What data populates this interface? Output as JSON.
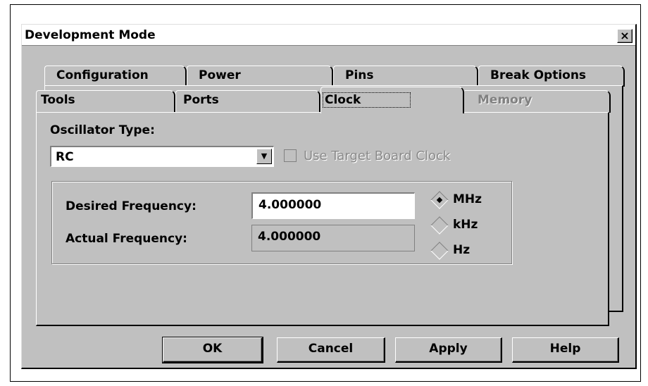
{
  "window": {
    "title": "Development Mode",
    "close_glyph": "×"
  },
  "tabs": {
    "back_row": [
      {
        "label": "Configuration"
      },
      {
        "label": "Power"
      },
      {
        "label": "Pins"
      },
      {
        "label": "Break Options"
      }
    ],
    "front_row": [
      {
        "label": "Tools"
      },
      {
        "label": "Ports"
      },
      {
        "label": "Clock",
        "selected": true
      },
      {
        "label": "Memory",
        "disabled": true
      }
    ]
  },
  "clock": {
    "oscillator_label": "Oscillator Type:",
    "oscillator_value": "RC",
    "use_target_board_clock": {
      "label": "Use Target Board Clock",
      "checked": false,
      "disabled": true
    },
    "desired_frequency": {
      "label": "Desired Frequency:",
      "value": "4.000000"
    },
    "actual_frequency": {
      "label": "Actual Frequency:",
      "value": "4.000000"
    },
    "units": [
      {
        "label": "MHz",
        "selected": true
      },
      {
        "label": "kHz",
        "selected": false
      },
      {
        "label": "Hz",
        "selected": false
      }
    ]
  },
  "buttons": {
    "ok": "OK",
    "cancel": "Cancel",
    "apply": "Apply",
    "help": "Help"
  },
  "colors": {
    "face": "#c0c0c0",
    "highlight": "#ffffff",
    "shadow": "#808080",
    "dark": "#000000"
  }
}
